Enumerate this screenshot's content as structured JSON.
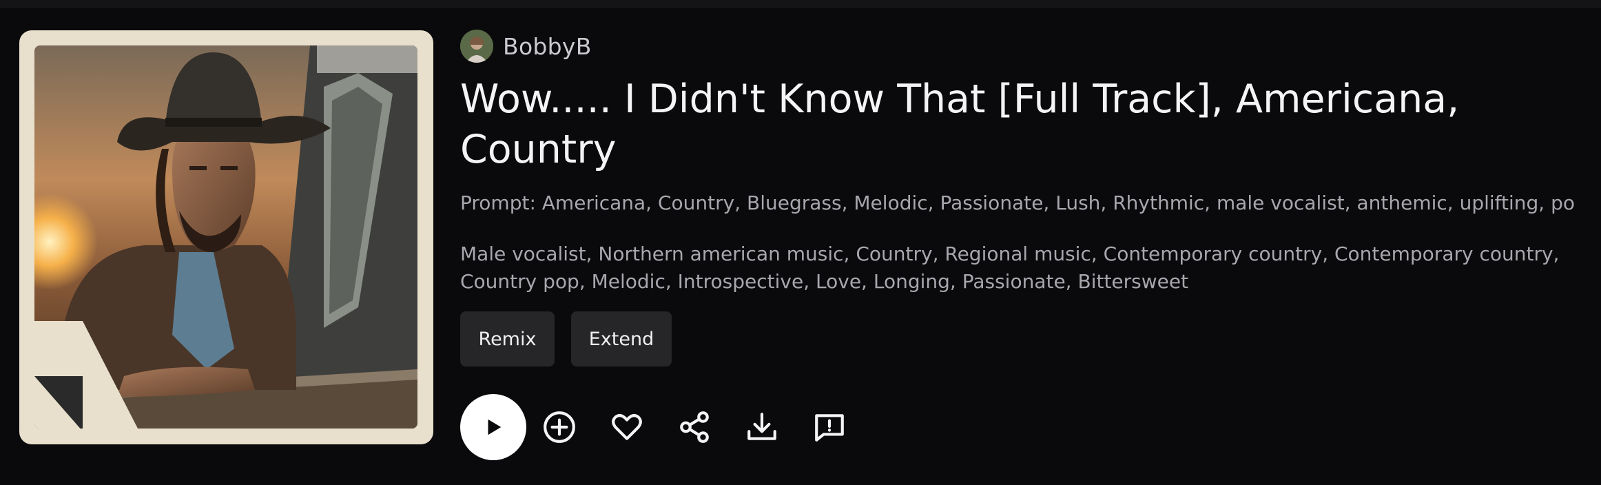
{
  "author": {
    "name": "BobbyB",
    "avatar_icon": "user-avatar"
  },
  "song": {
    "title": "Wow..... I Didn't Know That [Full Track], Americana, Country",
    "prompt": "Prompt: Americana, Country, Bluegrass, Melodic, Passionate, Lush, Rhythmic, male vocalist, anthemic, uplifting, pop,...",
    "tags": "Male vocalist, Northern american music, Country, Regional music, Contemporary country, Contemporary country, Country pop, Melodic, Introspective, Love, Longing, Passionate, Bittersweet"
  },
  "buttons": {
    "remix_label": "Remix",
    "extend_label": "Extend"
  },
  "actions": {
    "play_icon": "play-icon",
    "add_icon": "plus-circle-icon",
    "like_icon": "heart-icon",
    "share_icon": "share-icon",
    "download_icon": "download-icon",
    "report_icon": "report-icon"
  },
  "colors": {
    "background": "#0a0a0c",
    "frame": "#e8e0cc",
    "pill": "#262629",
    "text_primary": "#f4f4f6",
    "text_secondary": "#a7a7ae"
  }
}
